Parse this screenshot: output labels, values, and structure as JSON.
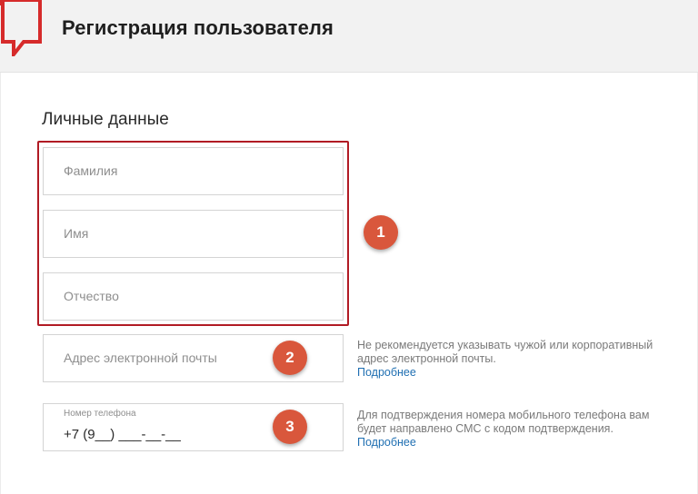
{
  "header": {
    "title": "Регистрация пользователя",
    "logo_icon": "speech-bubble-logo-icon",
    "logo_color": "#d62b2b"
  },
  "personal": {
    "section_title": "Личные данные",
    "surname_placeholder": "Фамилия",
    "name_placeholder": "Имя",
    "patronymic_placeholder": "Отчество"
  },
  "email": {
    "placeholder": "Адрес электронной почты",
    "hint_text": "Не рекомендуется указывать чужой или корпоративный адрес электронной почты.",
    "hint_link": "Подробнее"
  },
  "phone": {
    "label": "Номер телефона",
    "value": "+7 (9__) ___-__-__",
    "hint_text": "Для подтверждения номера мобильного телефона вам будет направлено СМС с кодом подтверждения.",
    "hint_link": "Подробнее"
  },
  "annotations": {
    "badge_1": "1",
    "badge_2": "2",
    "badge_3": "3",
    "badge_color": "#d9573c",
    "highlight_color": "#b11b24"
  }
}
